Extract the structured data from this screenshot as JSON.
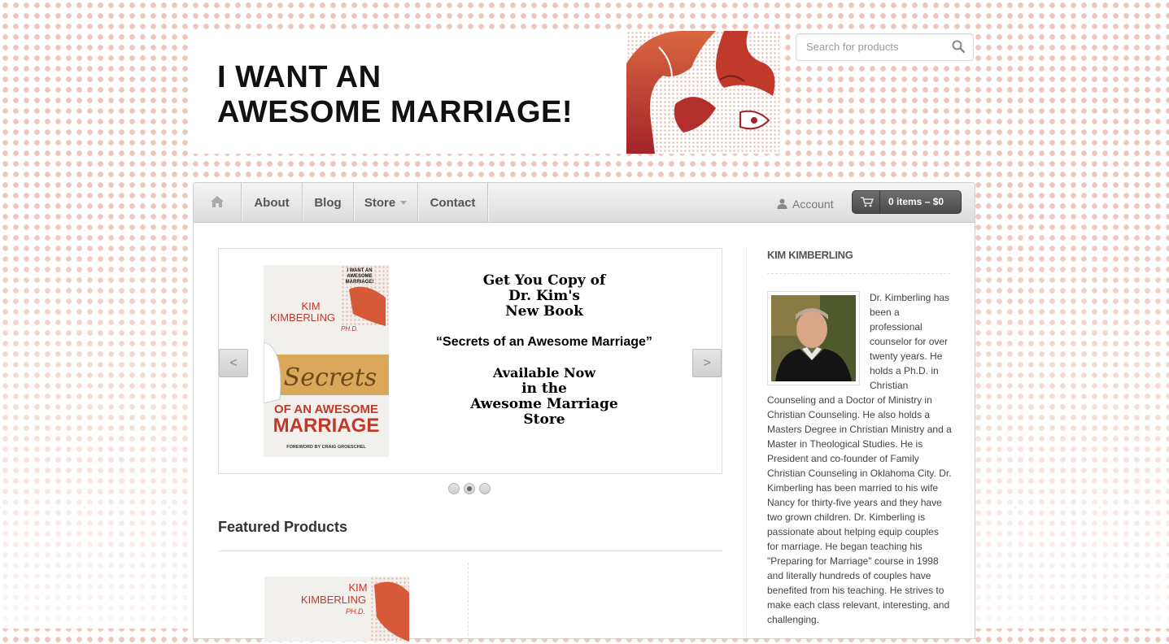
{
  "header": {
    "title_line1": "I WANT AN",
    "title_line2": "AWESOME MARRIAGE!",
    "search": {
      "placeholder": "Search for products"
    }
  },
  "nav": {
    "items": [
      {
        "label": "Home",
        "icon": "home-icon"
      },
      {
        "label": "About"
      },
      {
        "label": "Blog"
      },
      {
        "label": "Store",
        "has_dropdown": true
      },
      {
        "label": "Contact"
      }
    ],
    "account_label": "Account",
    "cart_label": "0 items – $0"
  },
  "slider": {
    "book": {
      "cover_title": "I WANT AN AWESOME MARRIAGE!",
      "author_first": "KIM",
      "author_last": "KIMBERLING",
      "degree": "PH.D.",
      "script_title": "Secrets",
      "subtitle_1": "OF AN AWESOME",
      "subtitle_2": "MARRIAGE",
      "foreword": "FOREWORD BY CRAIG GROESCHEL"
    },
    "promo": {
      "line1": "Get You Copy of",
      "line2": "Dr. Kim's",
      "line3": "New Book",
      "line4": "“Secrets of an Awesome Marriage”",
      "line5": "Available Now",
      "line6": "in the",
      "line7": "Awesome Marriage",
      "line8": "Store"
    },
    "prev_label": "<",
    "next_label": ">",
    "dots": 3,
    "active_dot": 2
  },
  "featured": {
    "title": "Featured Products",
    "product": {
      "author_first": "KIM",
      "author_last": "KIMBERLING",
      "degree": "PH.D."
    }
  },
  "sidebar": {
    "title": "KIM KIMBERLING",
    "bio": "Dr. Kimberling has been a professional counselor for over twenty years. He holds a Ph.D. in Christian Counseling and a Doctor of Ministry in Christian Counseling. He also holds a Masters Degree in Christian Ministry and a Master in Theological Studies. He is President and co-founder of Family Christian Counseling in Oklahoma City. Dr. Kimberling has been married to his wife Nancy for thirty-five years and they have two grown children. Dr. Kimberling is passionate about helping equip couples for marriage. He began teaching his \"Preparing for Marriage\" course in 1998 and literally hundreds of couples have benefited from his teaching. He strives to make each class relevant, interesting, and challenging."
  },
  "colors": {
    "accent_red": "#c0392b",
    "pattern_dot": "#e29682",
    "cart_bg": "#555555"
  }
}
